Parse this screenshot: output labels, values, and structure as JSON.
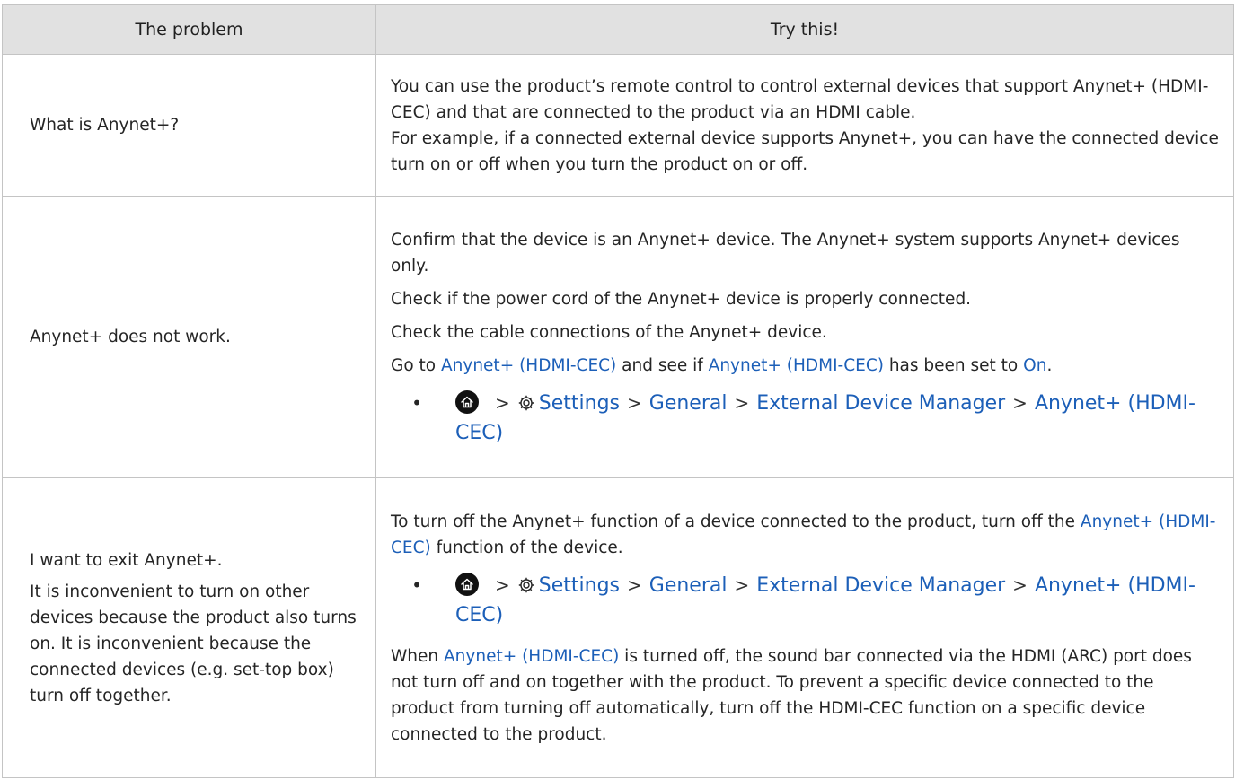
{
  "header": {
    "problem": "The problem",
    "try_this": "Try this!"
  },
  "rows": [
    {
      "problem": [
        "What is Anynet+?"
      ],
      "solution": {
        "p1": "You can use the product’s remote control to control external devices that support Anynet+ (HDMI-CEC) and that are connected to the product via an HDMI cable.",
        "p2": "For example, if a connected external device supports Anynet+, you can have the connected device turn on or off when you turn the product on or off."
      }
    },
    {
      "problem": [
        "Anynet+ does not work."
      ],
      "solution": {
        "p1": "Confirm that the device is an Anynet+ device. The Anynet+ system supports Anynet+ devices only.",
        "p2": "Check if the power cord of the Anynet+ device is properly connected.",
        "p3": "Check the cable connections of the Anynet+ device.",
        "p4_pre": "Go to ",
        "p4_link1": "Anynet+ (HDMI-CEC)",
        "p4_mid": " and see if ",
        "p4_link2": "Anynet+ (HDMI-CEC)",
        "p4_mid2": " has been set to ",
        "p4_link3": "On",
        "p4_end": "."
      }
    },
    {
      "problem": [
        "I want to exit Anynet+.",
        "It is inconvenient to turn on other devices because the product also turns on. It is inconvenient because the connected devices (e.g. set-top box) turn off together."
      ],
      "solution": {
        "p1_pre": "To turn off the Anynet+ function of a device connected to the product, turn off the ",
        "p1_link": "Anynet+ (HDMI-CEC)",
        "p1_end": " function of the device.",
        "p2_link": "Anynet+ (HDMI-CEC)",
        "p2_rest": " is turned off, the sound bar connected via the HDMI (ARC) port does not turn off and on together with the product. To prevent a specific device connected to the product from turning off automatically, turn off the HDMI-CEC function on a specific device connected to the product.",
        "p2_pre": "When "
      }
    }
  ],
  "menu_path": {
    "bullet": "•",
    "home_icon": "home-icon",
    "gear_icon": "gear-icon",
    "separator": ">",
    "settings": "Settings",
    "general": "General",
    "manager": "External Device Manager",
    "anynet": "Anynet+ (HDMI-CEC)"
  },
  "colors": {
    "link": "#1c5fb8",
    "header_bg": "#e1e1e1",
    "border": "#c4c4c4",
    "text": "#252525"
  }
}
